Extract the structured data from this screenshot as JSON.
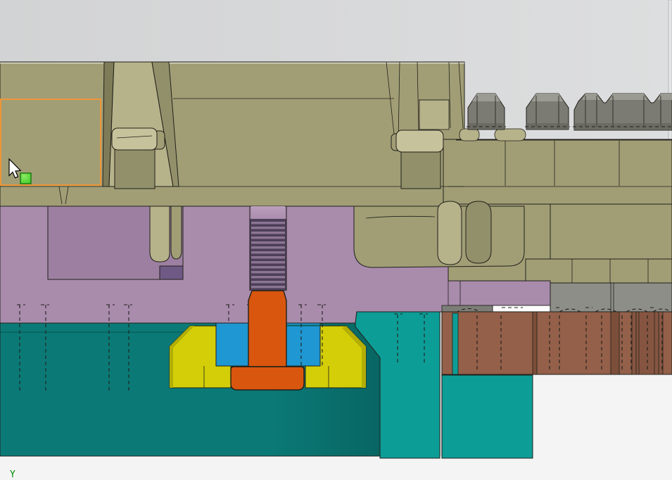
{
  "viewport": {
    "axis_label": "Y",
    "description": "CAD section view of mold tool assembly",
    "cursor": "arrow-pointer",
    "selection_state": "rubber-band-active"
  },
  "palette": {
    "bg_top": "#d2d3d4",
    "bg_top_hi": "#dddedf",
    "bg_bottom": "#f4f4f5",
    "khaki": "#a19e76",
    "khaki_light": "#b6b28a",
    "khaki_lighter": "#c6c29b",
    "khaki_mid": "#92906a",
    "khaki_dark": "#7e7b58",
    "purple": "#a98bac",
    "purple_pocket": "#9d80a1",
    "purple_deep": "#6f5a86",
    "purple_hi": "#bb9fbd",
    "thread_bg": "#4e3f58",
    "thread_stripe": "#8b7594",
    "teal_dark": "#0b7a77",
    "teal_mid": "#0d9d97",
    "yellow": "#d3ce08",
    "yellow_dark": "#b2ae06",
    "blue": "#1f97d2",
    "orange": "#d9560e",
    "brown": "#94604a",
    "brown_dark": "#7c4f3a",
    "brown_mid": "#865541",
    "gray_band": "#8e8e89",
    "gray_sliver": "#7d7d78",
    "bolt_side": "#7b7b74",
    "bolt_top": "#9b9b94",
    "bolt_dark": "#5f5f58",
    "white": "#fdfdfd",
    "outline": "#20201a",
    "selection_orange": "#ee9637",
    "handle_green": "#45cf2e",
    "handle_green_hi": "#8cea63",
    "handle_border": "#1d7a12",
    "axis_green": "#008a00"
  }
}
